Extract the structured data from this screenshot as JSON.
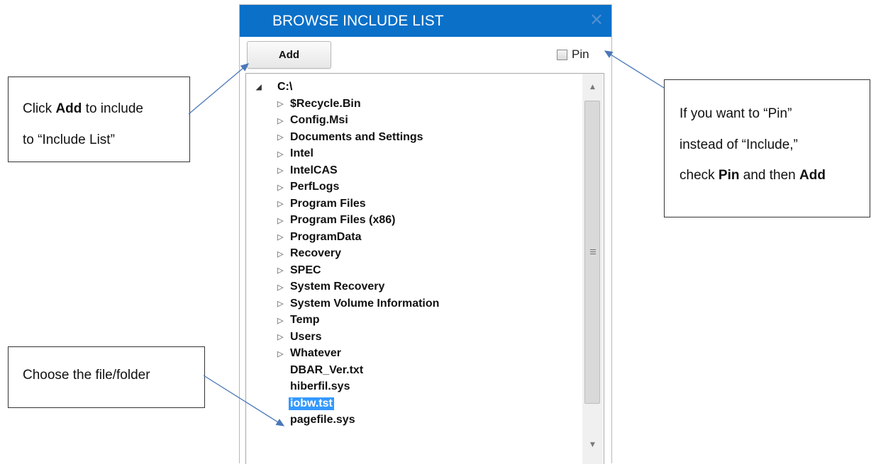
{
  "dialog": {
    "title": "BROWSE INCLUDE LIST",
    "close_glyph": "✕",
    "add_label": "Add",
    "pin_label": "Pin",
    "pin_checked": false
  },
  "tree": {
    "root_label": "C:\\",
    "expanded_glyph": "◢",
    "collapsed_glyph": "▷",
    "items": [
      {
        "label": "$Recycle.Bin",
        "folder": true
      },
      {
        "label": "Config.Msi",
        "folder": true
      },
      {
        "label": "Documents and Settings",
        "folder": true
      },
      {
        "label": "Intel",
        "folder": true
      },
      {
        "label": "IntelCAS",
        "folder": true
      },
      {
        "label": "PerfLogs",
        "folder": true
      },
      {
        "label": "Program Files",
        "folder": true
      },
      {
        "label": "Program Files (x86)",
        "folder": true
      },
      {
        "label": "ProgramData",
        "folder": true
      },
      {
        "label": "Recovery",
        "folder": true
      },
      {
        "label": "SPEC",
        "folder": true
      },
      {
        "label": "System Recovery",
        "folder": true
      },
      {
        "label": "System Volume Information",
        "folder": true
      },
      {
        "label": "Temp",
        "folder": true
      },
      {
        "label": "Users",
        "folder": true
      },
      {
        "label": "Whatever",
        "folder": true
      },
      {
        "label": "DBAR_Ver.txt",
        "folder": false
      },
      {
        "label": "hiberfil.sys",
        "folder": false
      },
      {
        "label": "iobw.tst",
        "folder": false,
        "selected": true
      },
      {
        "label": "pagefile.sys",
        "folder": false
      }
    ],
    "selected_color": "#3399ff"
  },
  "scrollbar": {
    "up_glyph": "▲",
    "down_glyph": "▼"
  },
  "callouts": {
    "add": {
      "l1_pre": "Click ",
      "l1_bold": "Add",
      "l1_post": " to include",
      "l2": "to “Include List”"
    },
    "pin": {
      "l1": "If you want to “Pin”",
      "l2": "instead of “Include,”",
      "l3_pre": "check ",
      "l3_bold1": "Pin",
      "l3_mid": " and then ",
      "l3_bold2": "Add"
    },
    "choose": {
      "text": "Choose the file/folder"
    }
  },
  "colors": {
    "titlebar": "#0a70c8",
    "arrow": "#4a78b8"
  }
}
